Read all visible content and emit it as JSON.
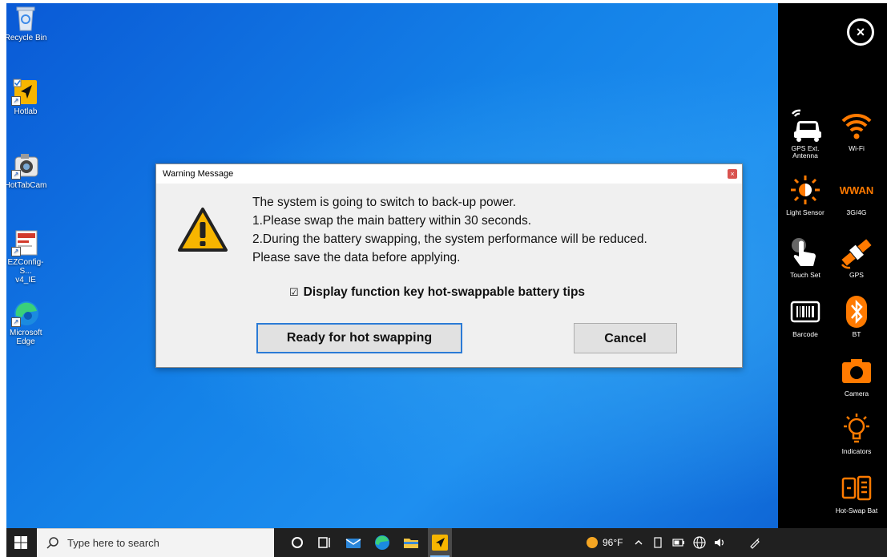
{
  "desktop": {
    "icons": [
      {
        "label": "Recycle Bin"
      },
      {
        "label": "Hotlab"
      },
      {
        "label": "HotTabCam"
      },
      {
        "label": "EZConfig-S...\nv4_IE"
      },
      {
        "label": "Microsoft Edge"
      }
    ]
  },
  "dialog": {
    "title": "Warning Message",
    "close": "×",
    "lines": [
      "The system is going to switch to back-up power.",
      "1.Please swap the main battery within 30 seconds.",
      "2.During the battery swapping, the system performance will be reduced.",
      "Please save the data before applying."
    ],
    "checkbox_glyph": "☑",
    "checkbox_label": "Display function key hot-swappable battery tips",
    "ready_button": "Ready for hot swapping",
    "cancel_button": "Cancel"
  },
  "panel": {
    "close": "×",
    "items": [
      {
        "label": "GPS Ext.\nAntenna",
        "icon": "car-antenna-icon"
      },
      {
        "label": "Wi-Fi",
        "icon": "wifi-icon"
      },
      {
        "label": "Light Sensor",
        "icon": "light-sensor-icon"
      },
      {
        "label": "3G/4G",
        "icon_text": "WWAN"
      },
      {
        "label": "Touch Set",
        "icon": "touch-icon"
      },
      {
        "label": "GPS",
        "icon": "satellite-icon"
      },
      {
        "label": "Barcode",
        "icon": "barcode-icon"
      },
      {
        "label": "BT",
        "icon": "bluetooth-icon"
      },
      {
        "label": "Camera",
        "icon": "camera-icon"
      },
      {
        "label": "Indicators",
        "icon": "bulb-icon"
      },
      {
        "label": "Hot-Swap Bat",
        "icon": "hot-swap-battery-icon"
      }
    ],
    "accent": "#ff7a00"
  },
  "taskbar": {
    "search_placeholder": "Type here to search",
    "weather": "96°F"
  }
}
